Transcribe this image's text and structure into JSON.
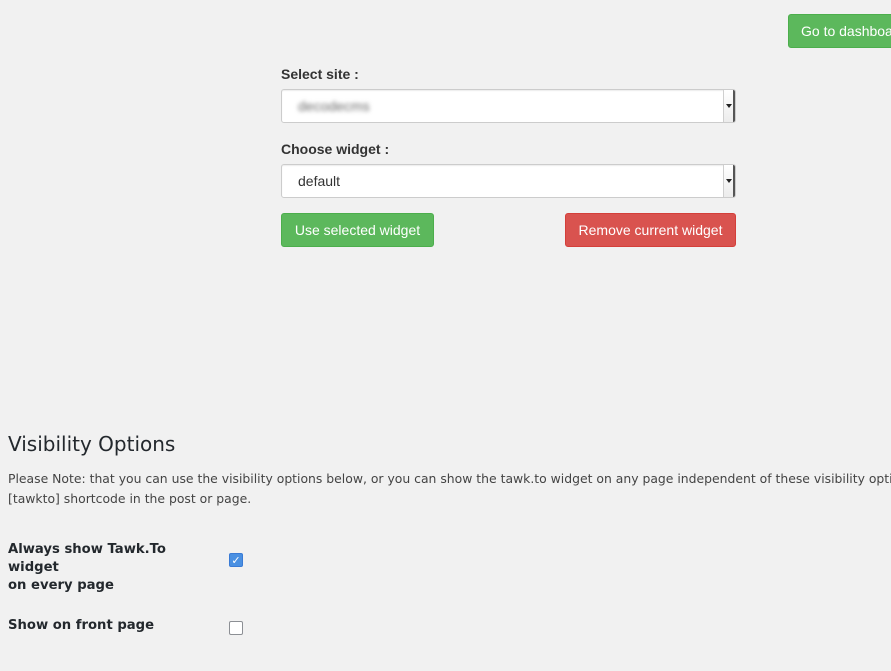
{
  "header": {
    "dashboard_label": "Go to dashboard"
  },
  "site_select": {
    "label": "Select site :",
    "selected_value": "decodecms"
  },
  "widget_select": {
    "label": "Choose widget :",
    "selected_value": "default"
  },
  "actions": {
    "use_label": "Use selected widget",
    "remove_label": "Remove current widget"
  },
  "visibility": {
    "title": "Visibility Options",
    "note_line1": "Please Note: that you can use the visibility options below, or you can show the tawk.to widget on any page independent of these visibility options b",
    "note_line2": "[tawkto] shortcode in the post or page.",
    "options": [
      {
        "label_line1": "Always show Tawk.To widget",
        "label_line2": "on every page",
        "checked": true
      },
      {
        "label_line1": "Show on front page",
        "label_line2": "",
        "checked": false
      }
    ]
  },
  "colors": {
    "success": "#5cb85c",
    "danger": "#d9534f",
    "checkbox_checked": "#4a90e2",
    "background": "#f1f1f1"
  }
}
